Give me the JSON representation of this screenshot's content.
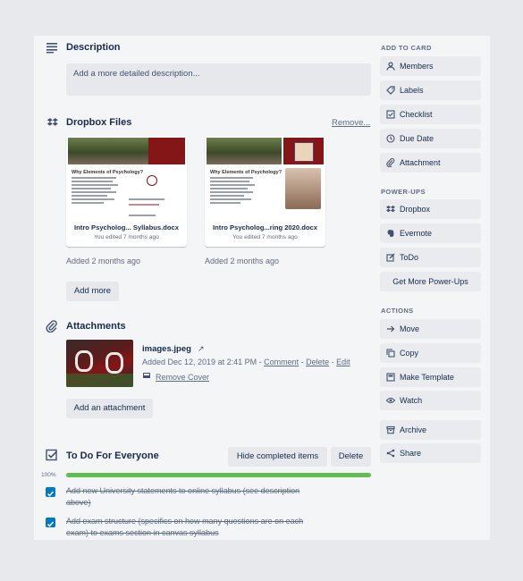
{
  "description": {
    "title": "Description",
    "placeholder": "Add a more detailed description..."
  },
  "dropbox": {
    "title": "Dropbox Files",
    "remove_label": "Remove...",
    "files": [
      {
        "name": "Intro Psycholog... Syllabus.docx",
        "edited": "You edited 7 months ago",
        "added": "Added 2 months ago",
        "doc_heading": "Why Elements of Psychology?"
      },
      {
        "name": "Intro Psycholog...ring 2020.docx",
        "edited": "You edited 7 months ago",
        "added": "Added 2 months ago",
        "doc_heading": "Why Elements of Psychology?"
      }
    ],
    "add_more_label": "Add more"
  },
  "attachments": {
    "title": "Attachments",
    "item": {
      "filename": "images.jpeg",
      "meta_prefix": "Added Dec 12, 2019 at 2:41 PM - ",
      "comment": "Comment",
      "sep1": " - ",
      "delete": "Delete",
      "sep2": " - ",
      "edit": "Edit",
      "remove_cover": "Remove Cover"
    },
    "add_label": "Add an attachment"
  },
  "checklist": {
    "title": "To Do For Everyone",
    "hide_label": "Hide completed items",
    "delete_label": "Delete",
    "progress_text": "100%",
    "progress": 1.0,
    "items": [
      {
        "text": "Add new University statements to online syllabus (see description above)",
        "checked": true
      },
      {
        "text": "Add exam structure (specifics on how many questions are on each exam) to exams section in canvas syllabus",
        "checked": true
      }
    ]
  },
  "sidebar": {
    "add_heading": "ADD TO CARD",
    "add_items": [
      {
        "label": "Members",
        "icon": "person-icon"
      },
      {
        "label": "Labels",
        "icon": "tag-icon"
      },
      {
        "label": "Checklist",
        "icon": "checklist-icon"
      },
      {
        "label": "Due Date",
        "icon": "clock-icon"
      },
      {
        "label": "Attachment",
        "icon": "paperclip-icon"
      }
    ],
    "powerups_heading": "POWER-UPS",
    "powerups": [
      {
        "label": "Dropbox",
        "icon": "dropbox-icon"
      },
      {
        "label": "Evernote",
        "icon": "evernote-icon"
      },
      {
        "label": "ToDo",
        "icon": "edit-icon"
      }
    ],
    "more_powerups": "Get More Power-Ups",
    "actions_heading": "ACTIONS",
    "actions": [
      {
        "label": "Move",
        "icon": "arrow-right-icon"
      },
      {
        "label": "Copy",
        "icon": "copy-icon"
      },
      {
        "label": "Make Template",
        "icon": "template-icon"
      },
      {
        "label": "Watch",
        "icon": "eye-icon"
      },
      {
        "label": "Archive",
        "icon": "archive-icon"
      },
      {
        "label": "Share",
        "icon": "share-icon"
      }
    ]
  },
  "colors": {
    "progress": "#61bd4f",
    "checkbox": "#0079bf",
    "ou_crimson": "#841617"
  }
}
